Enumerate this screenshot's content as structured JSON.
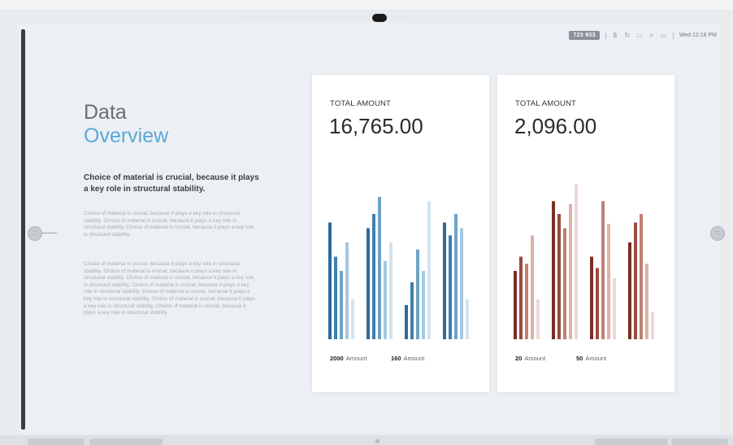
{
  "status_bar": {
    "badge": "723 933",
    "icons": [
      "dollar-icon",
      "refresh-icon",
      "lock-icon",
      "wifi-icon",
      "battery-icon"
    ],
    "datetime": "Wed 12:16 PM"
  },
  "heading": {
    "line1": "Data",
    "line2": "Overview"
  },
  "lead": "Choice of material is crucial, because it plays a key role in structural stability.",
  "paragraphs": [
    "Choice of material is crucial, because it plays a key role in structural stability. Choice of material is crucial, because it plays a key role in structural stability. Choice of material is crucial, because it plays a key role in structural stability.",
    "Choice of material is crucial, because it plays a key role in structural stability. Choice of material is crucial, because it plays a key role in structural stability. Choice of material is crucial, because it plays a key role in structural stability. Choice of material is crucial, because it plays a key role in structural stability. Choice of material is crucial, because it plays a key role in structural stability. Choice of material is crucial, because it plays a key role in structural stability. Choice of material is crucial, because it plays a key role in structural stability."
  ],
  "cards": [
    {
      "label": "TOTAL AMOUNT",
      "value": "16,765.00",
      "legend": [
        {
          "num": "2000",
          "text": "Amount"
        },
        {
          "num": "160",
          "text": "Amount"
        }
      ]
    },
    {
      "label": "TOTAL AMOUNT",
      "value": "2,096.00",
      "legend": [
        {
          "num": "20",
          "text": "Amount"
        },
        {
          "num": "50",
          "text": "Amount"
        }
      ]
    }
  ],
  "chart_data": [
    {
      "type": "bar",
      "colors": [
        "#2e6a9a",
        "#3f7fae",
        "#6ea3c8",
        "#a5c8e0",
        "#d3e4f0"
      ],
      "groups": [
        [
          0.82,
          0.58,
          0.48,
          0.68,
          0.28
        ],
        [
          0.78,
          0.88,
          1.0,
          0.55,
          0.68
        ],
        [
          0.24,
          0.4,
          0.63,
          0.48,
          0.97
        ],
        [
          0.82,
          0.73,
          0.88,
          0.78,
          0.28
        ]
      ]
    },
    {
      "type": "bar",
      "colors": [
        "#7a2e25",
        "#9b4a3e",
        "#c08075",
        "#d9b3ab",
        "#ecd8d3"
      ],
      "groups": [
        [
          0.48,
          0.58,
          0.53,
          0.73,
          0.28
        ],
        [
          0.97,
          0.88,
          0.78,
          0.95,
          1.09
        ],
        [
          0.58,
          0.5,
          0.97,
          0.81,
          0.43
        ],
        [
          0.68,
          0.82,
          0.88,
          0.53,
          0.19
        ]
      ]
    }
  ]
}
